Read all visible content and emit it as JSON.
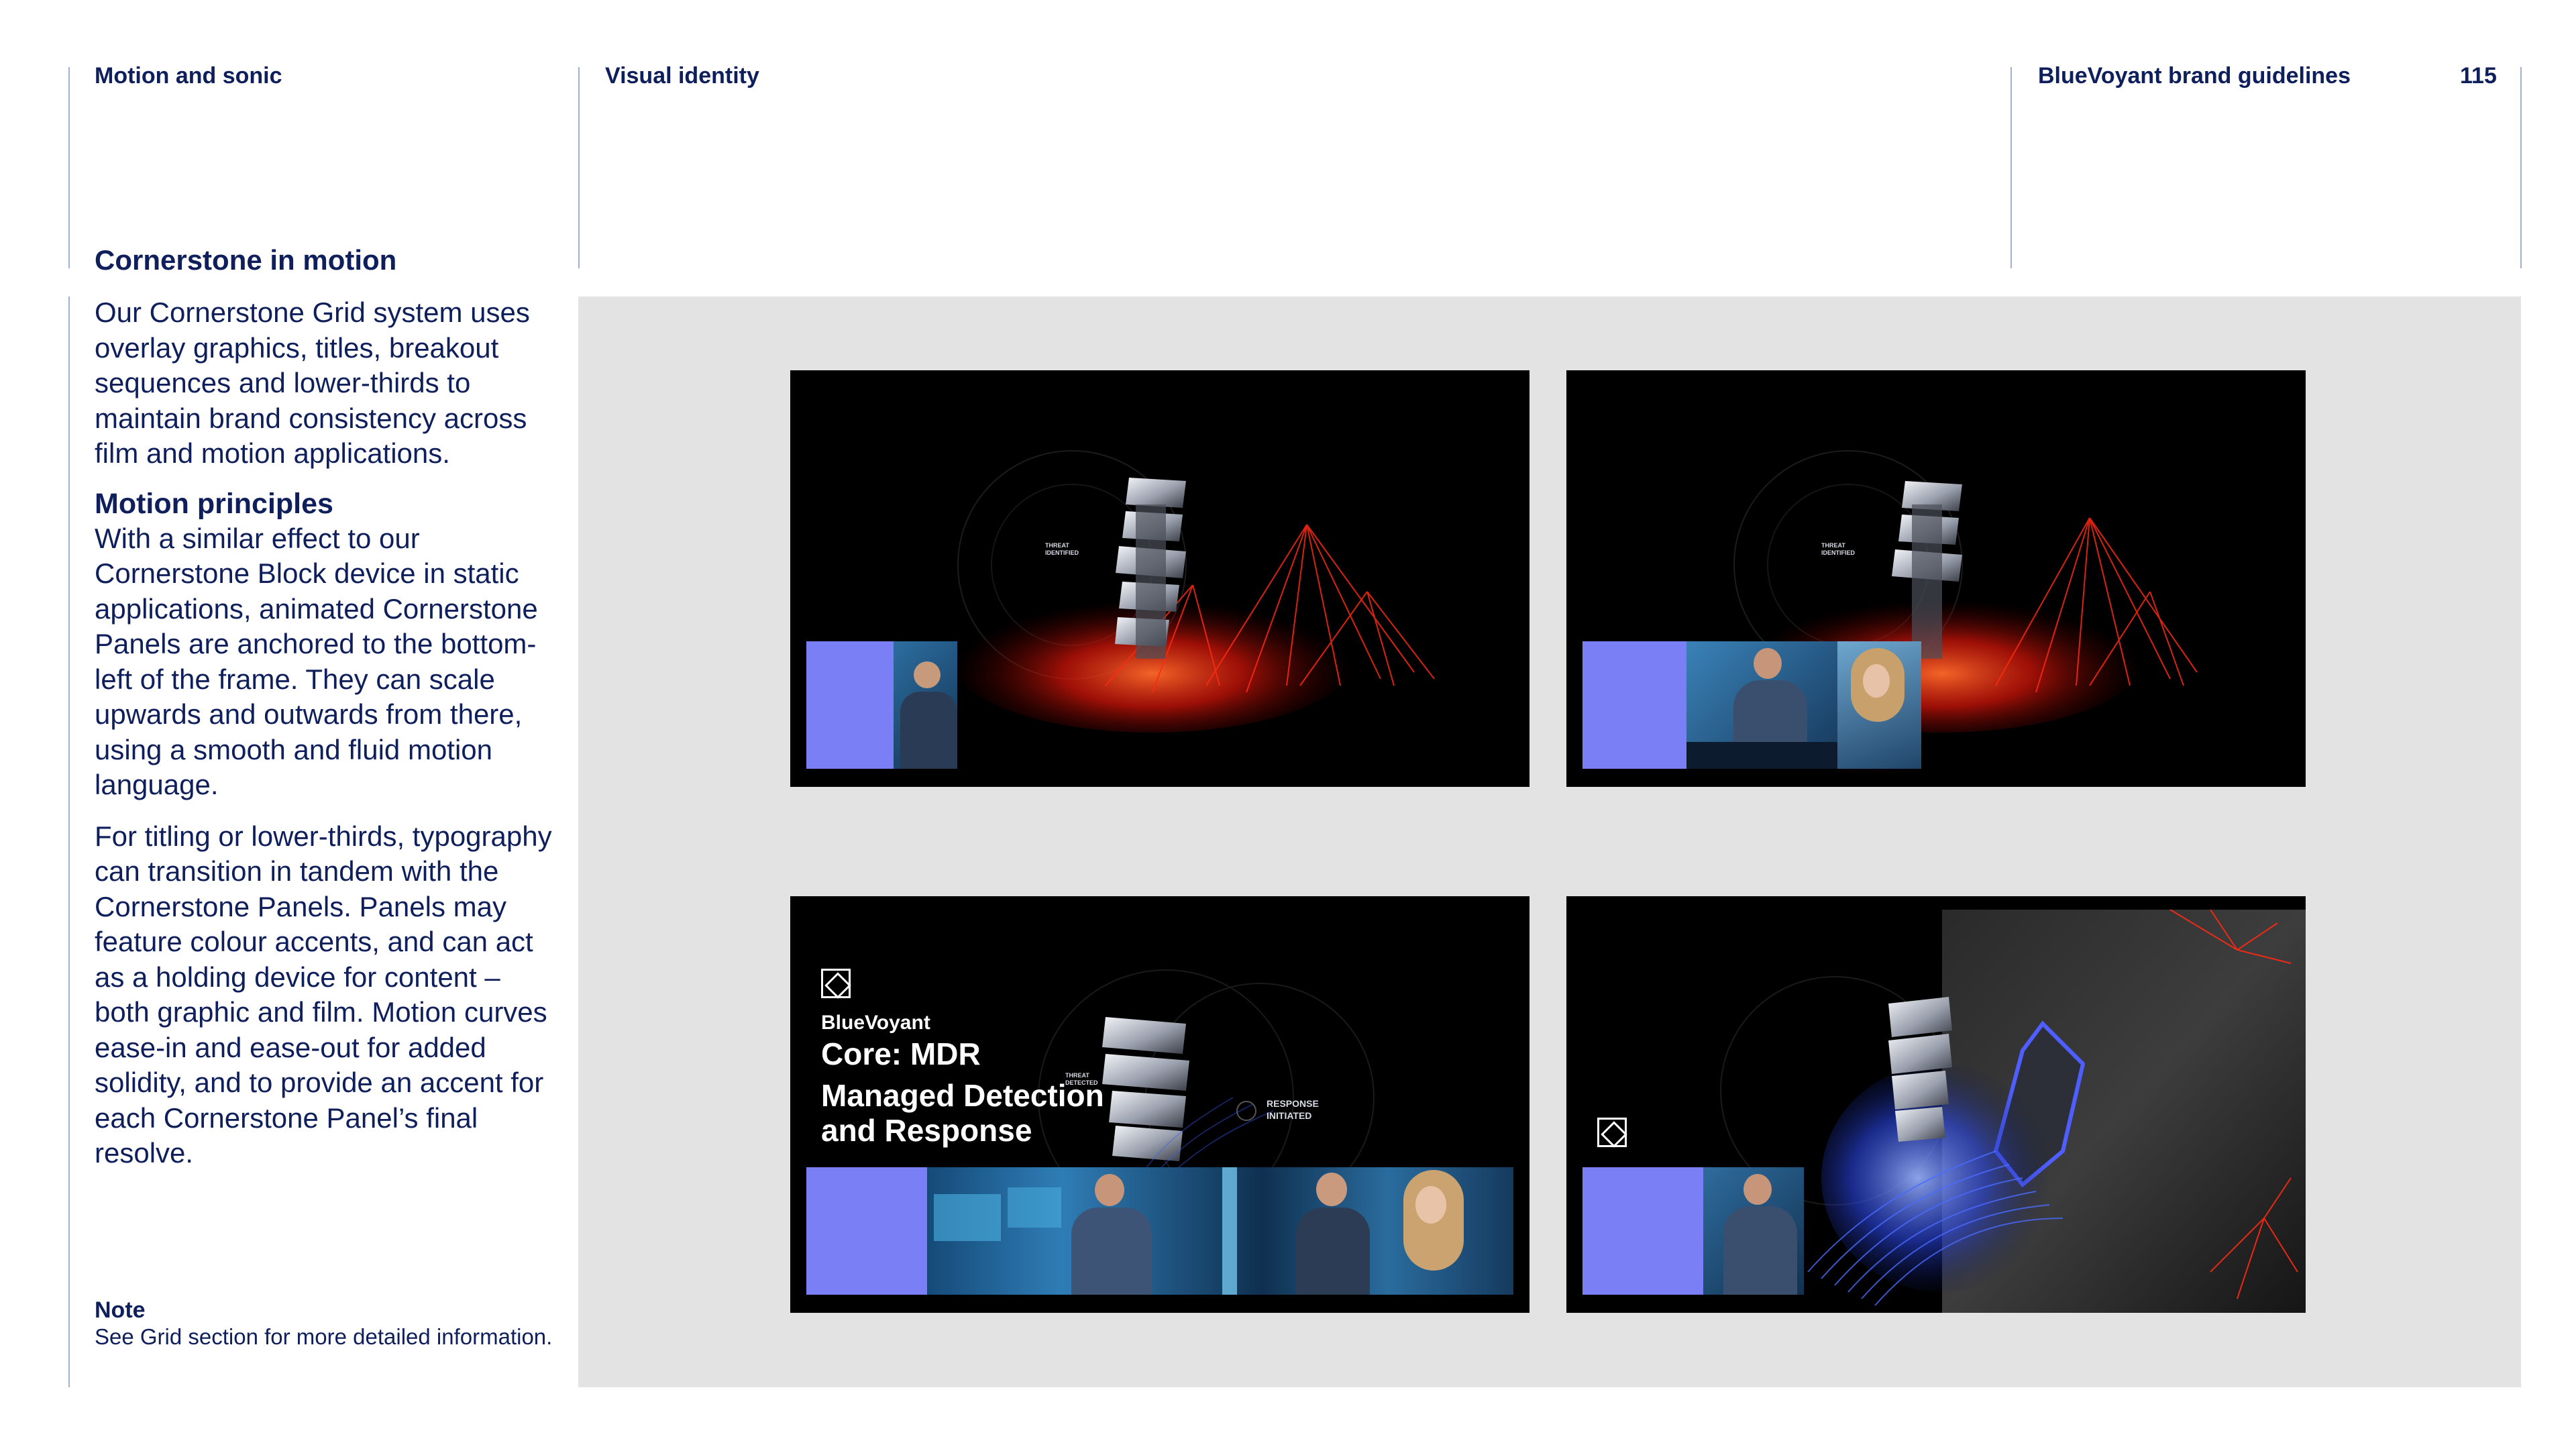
{
  "header": {
    "section": "Motion and sonic",
    "chapter": "Visual identity",
    "doc_title": "BlueVoyant brand guidelines",
    "page_number": "115"
  },
  "content": {
    "title": "Cornerstone in motion",
    "intro": "Our Cornerstone Grid system uses overlay graphics, titles, breakout sequences and lower-thirds to maintain brand consistency across film and motion applications.",
    "principles_title": "Motion principles",
    "principles_p1": "With a similar effect to our Cornerstone Block device in static applications, animated Cornerstone Panels are anchored to the bottom-left of the frame. They can scale upwards and outwards from there, using a smooth and fluid motion language.",
    "principles_p2": "For titling or lower-thirds, typography can transition in tandem with the Cornerstone Panels. Panels may feature colour accents, and can act as a holding device for content – both graphic and film. Motion curves ease-in and ease-out for added solidity, and to provide an accent for each Cornerstone Panel’s final resolve.",
    "note_label": "Note",
    "note_text": "See Grid section for more detailed information."
  },
  "frames": {
    "f1": {
      "hud": "THREAT IDENTIFIED"
    },
    "f2": {
      "hud": "THREAT IDENTIFIED"
    },
    "f3": {
      "hud_left": "THREAT DETECTED",
      "hud_right": "RESPONSE INITIATED",
      "brand": "BlueVoyant",
      "product": "Core: MDR",
      "headline_1": "Managed Detection",
      "headline_2": "and Response"
    }
  },
  "colors": {
    "navy": "#0f1f5c",
    "rule": "#9fb0d4",
    "gallery_bg": "#e3e3e3",
    "violet_panel": "#7b7ff6",
    "fx_red": "#ff2a12",
    "fx_blue": "#3d5cff"
  },
  "icons": [
    "bluevoyant-logo-icon"
  ]
}
